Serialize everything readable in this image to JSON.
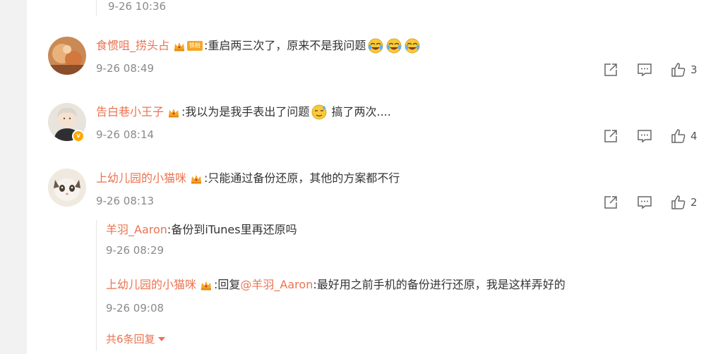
{
  "top": {
    "time": "9-26 10:36"
  },
  "comments": [
    {
      "username": "食惯咀_捞头占",
      "badge": "铁粉",
      "text": ":重启两三次了，原来不是我问题",
      "time": "9-26 08:49",
      "likes": "3"
    },
    {
      "username": "告白巷小王子",
      "text_before": ":我以为是我手表出了问题",
      "text_after": " 搞了两次....",
      "time": "9-26 08:14",
      "likes": "4"
    },
    {
      "username": "上幼儿园的小猫咪",
      "text": ":只能通过备份还原，其他的方案都不行",
      "time": "9-26 08:13",
      "likes": "2"
    }
  ],
  "replies": [
    {
      "username": "羊羽_Aaron",
      "text": ":备份到iTunes里再还原吗",
      "time": "9-26 08:29"
    },
    {
      "username": "上幼儿园的小猫咪",
      "prefix": ":回复",
      "mention": "@羊羽_Aaron",
      "text": ":最好用之前手机的备份进行还原，我是这样弄好的",
      "time": "9-26 09:08"
    }
  ],
  "more_replies": "共6条回复",
  "icons": {
    "share": "share-icon",
    "comment": "comment-icon",
    "like": "thumbs-up-icon",
    "crown": "crown-icon",
    "emoji_laugh_cry": "laugh-cry-emoji-icon",
    "emoji_sweat": "sweat-emoji-icon"
  },
  "colors": {
    "username": "#eb7350",
    "text": "#333333",
    "time": "#8a8a8a",
    "badge": "#f5a623"
  }
}
